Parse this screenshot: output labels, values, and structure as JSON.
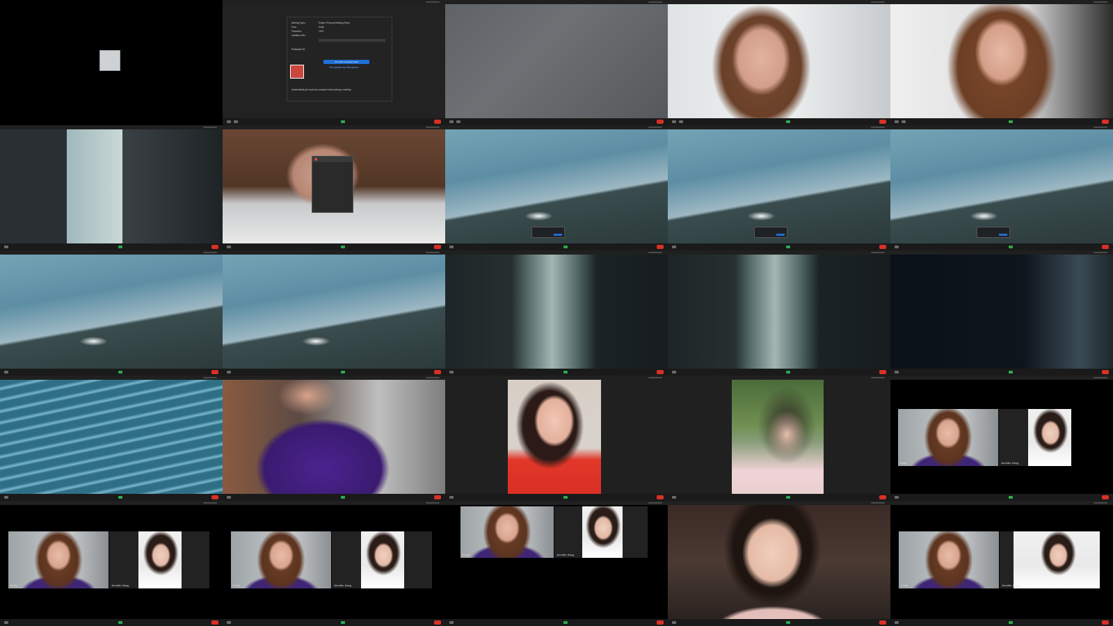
{
  "meeting": {
    "dialog_title": "Zoom",
    "meeting_topic_label": "Meeting Topic:",
    "meeting_topic_value": "Emily's Personal Meeting Room",
    "host_label": "Host:",
    "host_value": "Emily",
    "password_label": "Password:",
    "password_value": "1234",
    "invite_url_label": "Invitation URL:",
    "participant_id_label": "Participant ID:",
    "join_audio_button": "Join with Computer Audio",
    "test_audio_link": "Test Speaker and Microphone",
    "auto_join_checkbox": "Automatically join audio by computer when joining a meeting"
  },
  "tiles": {
    "r4c2": {
      "left_name": "Emily",
      "right_name": "Jennifer Jiang"
    },
    "r5c1": {
      "left_name": "Emily",
      "right_name": "Jennifer Jiang"
    },
    "r5c2": {
      "left_name": "Emily",
      "right_name": "Jennifer Jiang"
    },
    "r5c3": {
      "left_name": "Emily",
      "right_name": "Jennifer Jiang"
    },
    "r5c5": {
      "left_name": "Emily",
      "right_name": "Jennifer Jiang"
    }
  },
  "colors": {
    "end_button": "#d93025",
    "video_on": "#2fa84f",
    "accent_blue": "#1f6fd6"
  },
  "icons": [
    "microphone-icon",
    "video-icon",
    "security-icon",
    "participants-icon",
    "chat-icon",
    "share-screen-icon",
    "record-icon",
    "reactions-icon",
    "end-meeting-button"
  ]
}
